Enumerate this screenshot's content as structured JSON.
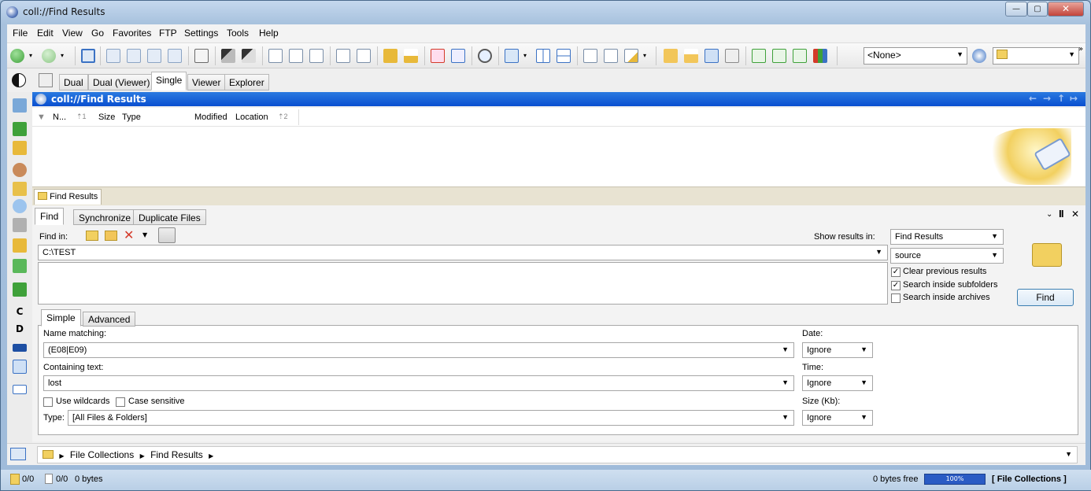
{
  "window": {
    "title": "coll://Find Results",
    "minimize": "—",
    "maximize": "▢",
    "close": "✕"
  },
  "menu": [
    "File",
    "Edit",
    "View",
    "Go",
    "Favorites",
    "FTP",
    "Settings",
    "Tools",
    "Help"
  ],
  "toolbar": {
    "style_combo": "<None>",
    "colors": {
      "blue": "#3b72c4",
      "green": "#3fa13a",
      "red": "#d43a2a",
      "yellow": "#e8b93a"
    }
  },
  "layout_buttons": [
    "Dual",
    "Dual (Viewer)",
    "Single",
    "Viewer",
    "Explorer"
  ],
  "pane": {
    "title": "coll://Find Results",
    "columns": {
      "name": "N...",
      "name_sort": "⇡1",
      "size": "Size",
      "type": "Type",
      "modified": "Modified",
      "location": "Location",
      "location_sort": "⇡2"
    },
    "results_tab": "Find Results"
  },
  "find": {
    "tabs": [
      "Find",
      "Synchronize",
      "Duplicate Files"
    ],
    "find_in_label": "Find in:",
    "find_in_value": "C:\\TEST",
    "show_results_label": "Show results in:",
    "show_results_value": "Find Results",
    "source_value": "source",
    "options": [
      {
        "label": "Clear previous results",
        "checked": true
      },
      {
        "label": "Search inside subfolders",
        "checked": true
      },
      {
        "label": "Search inside archives",
        "checked": false
      }
    ],
    "find_button": "Find",
    "subtabs": [
      "Simple",
      "Advanced"
    ],
    "name_matching_label": "Name matching:",
    "name_matching_value": "(E08|E09)",
    "containing_label": "Containing text:",
    "containing_value": "lost",
    "use_wildcards": "Use wildcards",
    "case_sensitive": "Case sensitive",
    "type_label": "Type:",
    "type_value": "[All Files & Folders]",
    "date_label": "Date:",
    "date_value": "Ignore",
    "time_label": "Time:",
    "time_value": "Ignore",
    "size_label": "Size (Kb):",
    "size_value": "Ignore"
  },
  "location": {
    "crumbs": [
      "File Collections",
      "Find Results"
    ]
  },
  "status": {
    "left1": "0/0",
    "left2": "0/0",
    "bytes": "0 bytes",
    "free": "0 bytes free",
    "percent": "100%",
    "collection": "[ File Collections ]"
  }
}
